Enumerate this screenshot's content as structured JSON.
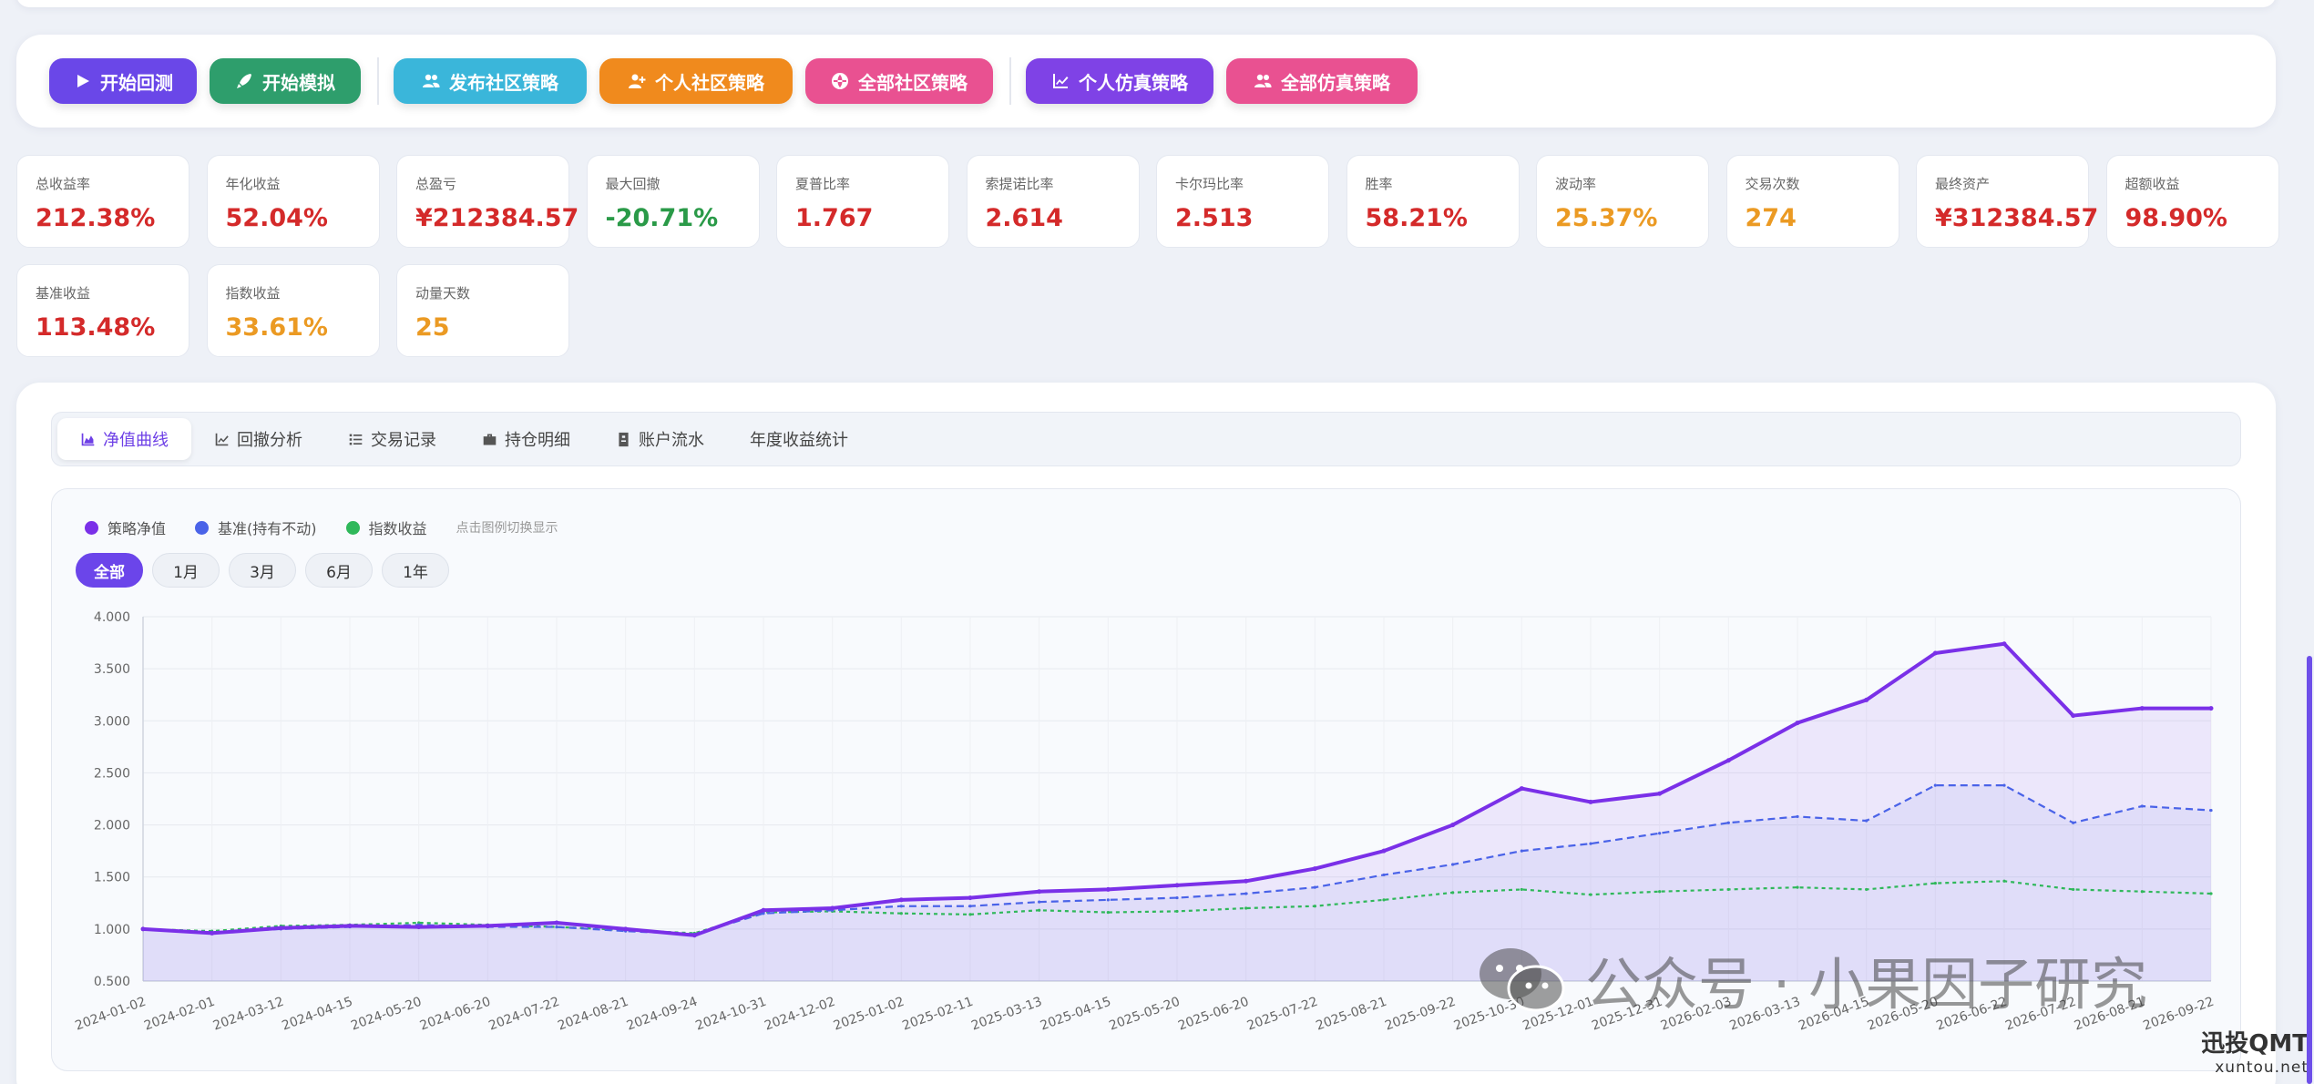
{
  "toolbar": {
    "buttons": [
      {
        "label": "开始回测",
        "icon": "play-icon",
        "color": "#6a47e8"
      },
      {
        "label": "开始模拟",
        "icon": "rocket-icon",
        "color": "#2e9e6c"
      },
      {
        "label": "发布社区策略",
        "icon": "users-icon",
        "color": "#3ab6da"
      },
      {
        "label": "个人社区策略",
        "icon": "user-plus-icon",
        "color": "#f08a1d"
      },
      {
        "label": "全部社区策略",
        "icon": "globe-icon",
        "color": "#e95191"
      },
      {
        "label": "个人仿真策略",
        "icon": "line-chart-icon",
        "color": "#7f42e6"
      },
      {
        "label": "全部仿真策略",
        "icon": "users-icon",
        "color": "#e95191"
      }
    ]
  },
  "metrics": [
    {
      "label": "总收益率",
      "value": "212.38%",
      "color": "#d42a2a"
    },
    {
      "label": "年化收益",
      "value": "52.04%",
      "color": "#d42a2a"
    },
    {
      "label": "总盈亏",
      "value": "¥212384.57",
      "color": "#d42a2a"
    },
    {
      "label": "最大回撤",
      "value": "-20.71%",
      "color": "#2a9a48"
    },
    {
      "label": "夏普比率",
      "value": "1.767",
      "color": "#d42a2a"
    },
    {
      "label": "索提诺比率",
      "value": "2.614",
      "color": "#d42a2a"
    },
    {
      "label": "卡尔玛比率",
      "value": "2.513",
      "color": "#d42a2a"
    },
    {
      "label": "胜率",
      "value": "58.21%",
      "color": "#d42a2a"
    },
    {
      "label": "波动率",
      "value": "25.37%",
      "color": "#eb9a23"
    },
    {
      "label": "交易次数",
      "value": "274",
      "color": "#eb9a23"
    },
    {
      "label": "最终资产",
      "value": "¥312384.57",
      "color": "#d42a2a"
    },
    {
      "label": "超额收益",
      "value": "98.90%",
      "color": "#d42a2a"
    },
    {
      "label": "基准收益",
      "value": "113.48%",
      "color": "#d42a2a"
    },
    {
      "label": "指数收益",
      "value": "33.61%",
      "color": "#eb9a23"
    },
    {
      "label": "动量天数",
      "value": "25",
      "color": "#eb9a23"
    }
  ],
  "tabs": [
    {
      "label": "净值曲线",
      "icon": "area-chart-icon",
      "active": true
    },
    {
      "label": "回撤分析",
      "icon": "line-chart-icon",
      "active": false
    },
    {
      "label": "交易记录",
      "icon": "list-icon",
      "active": false
    },
    {
      "label": "持仓明细",
      "icon": "briefcase-icon",
      "active": false
    },
    {
      "label": "账户流水",
      "icon": "ledger-icon",
      "active": false
    },
    {
      "label": "年度收益统计",
      "icon": "",
      "active": false
    }
  ],
  "legend": {
    "hint": "点击图例切换显示"
  },
  "ranges": [
    {
      "label": "全部",
      "active": true
    },
    {
      "label": "1月",
      "active": false
    },
    {
      "label": "3月",
      "active": false
    },
    {
      "label": "6月",
      "active": false
    },
    {
      "label": "1年",
      "active": false
    }
  ],
  "chart_data": {
    "type": "line",
    "title": "",
    "xlabel": "",
    "ylabel": "",
    "ylim": [
      0.5,
      4.0
    ],
    "yticks": [
      "0.500",
      "1.000",
      "1.500",
      "2.000",
      "2.500",
      "3.000",
      "3.500",
      "4.000"
    ],
    "grid": true,
    "legend_position": "top-left",
    "x": [
      "2024-01-02",
      "2024-02-01",
      "2024-03-12",
      "2024-04-15",
      "2024-05-20",
      "2024-06-20",
      "2024-07-22",
      "2024-08-21",
      "2024-09-24",
      "2024-10-31",
      "2024-12-02",
      "2025-01-02",
      "2025-02-11",
      "2025-03-13",
      "2025-04-15",
      "2025-05-20",
      "2025-06-20",
      "2025-07-22",
      "2025-08-21",
      "2025-09-22",
      "2025-10-30",
      "2025-12-01",
      "2025-12-31",
      "2026-02-03",
      "2026-03-13",
      "2026-04-15",
      "2026-05-20",
      "2026-06-22",
      "2026-07-22",
      "2026-08-21",
      "2026-09-22"
    ],
    "series": [
      {
        "name": "策略净值",
        "color": "#7a30e8",
        "style": "solid",
        "values": [
          1.0,
          0.96,
          1.01,
          1.03,
          1.02,
          1.03,
          1.06,
          1.0,
          0.94,
          1.18,
          1.2,
          1.28,
          1.3,
          1.36,
          1.38,
          1.42,
          1.46,
          1.58,
          1.75,
          2.0,
          2.35,
          2.22,
          2.3,
          2.62,
          2.98,
          3.2,
          3.65,
          3.74,
          3.05,
          3.12,
          3.12
        ]
      },
      {
        "name": "基准(持有不动)",
        "color": "#4a63e8",
        "style": "dashed",
        "values": [
          1.0,
          0.97,
          1.0,
          1.02,
          1.04,
          1.02,
          1.02,
          0.98,
          0.95,
          1.15,
          1.18,
          1.22,
          1.22,
          1.26,
          1.28,
          1.3,
          1.34,
          1.4,
          1.52,
          1.62,
          1.75,
          1.82,
          1.92,
          2.02,
          2.08,
          2.04,
          2.38,
          2.38,
          2.02,
          2.18,
          2.14
        ]
      },
      {
        "name": "指数收益",
        "color": "#2fb85a",
        "style": "dashed",
        "values": [
          1.0,
          0.98,
          1.03,
          1.04,
          1.06,
          1.04,
          1.02,
          0.99,
          0.96,
          1.16,
          1.17,
          1.15,
          1.14,
          1.18,
          1.16,
          1.17,
          1.2,
          1.22,
          1.28,
          1.35,
          1.38,
          1.33,
          1.36,
          1.38,
          1.4,
          1.38,
          1.44,
          1.46,
          1.38,
          1.36,
          1.34
        ]
      }
    ]
  },
  "watermark": {
    "text": "公众号 · 小果因子研究",
    "brand": "迅投QMT",
    "domain": "xuntou.net"
  }
}
